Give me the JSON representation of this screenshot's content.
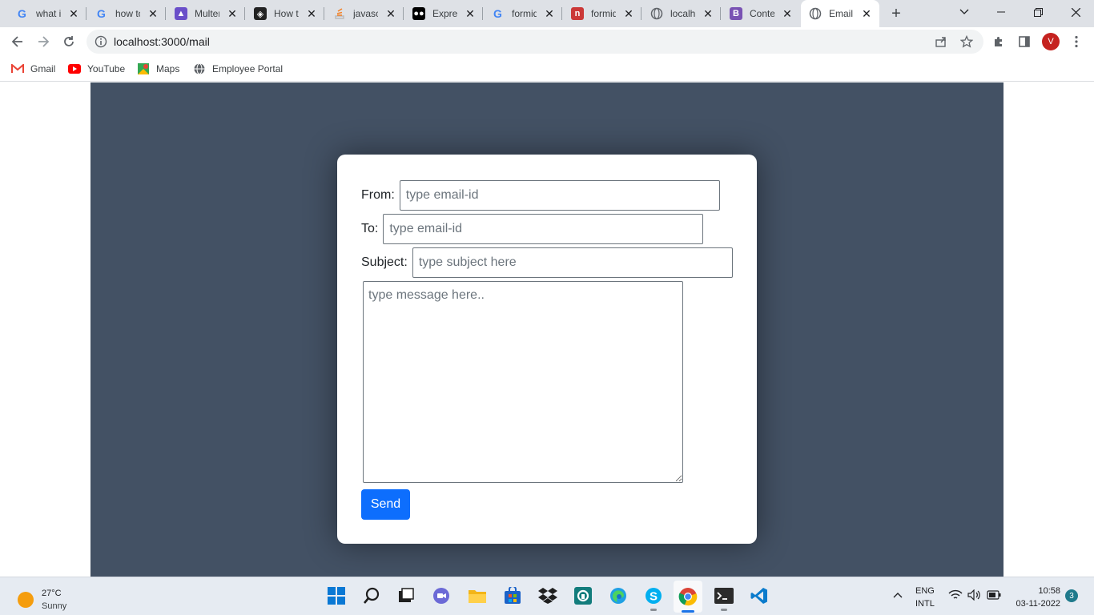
{
  "browser": {
    "tabs": [
      {
        "title": "what is",
        "icon": "google-icon",
        "active": false
      },
      {
        "title": "how to",
        "icon": "google-icon",
        "active": false
      },
      {
        "title": "Multer",
        "icon": "multer-icon",
        "active": false
      },
      {
        "title": "How to",
        "icon": "codepen-icon",
        "active": false
      },
      {
        "title": "javascr",
        "icon": "stackoverflow-icon",
        "active": false
      },
      {
        "title": "Expres",
        "icon": "medium-icon",
        "active": false
      },
      {
        "title": "formid",
        "icon": "google-icon",
        "active": false
      },
      {
        "title": "formid",
        "icon": "npm-icon",
        "active": false
      },
      {
        "title": "localho",
        "icon": "globe-icon",
        "active": false
      },
      {
        "title": "Conten",
        "icon": "bootstrap-icon",
        "active": false
      },
      {
        "title": "Email",
        "icon": "globe-icon",
        "active": true
      }
    ],
    "url": "localhost:3000/mail",
    "profile_initial": "V",
    "bookmarks": [
      {
        "label": "Gmail",
        "icon": "gmail-icon"
      },
      {
        "label": "YouTube",
        "icon": "youtube-icon"
      },
      {
        "label": "Maps",
        "icon": "maps-icon"
      },
      {
        "label": "Employee Portal",
        "icon": "globe-icon"
      }
    ]
  },
  "mail_form": {
    "from_label": "From:",
    "from_placeholder": "type email-id",
    "to_label": "To:",
    "to_placeholder": "type email-id",
    "subject_label": "Subject:",
    "subject_placeholder": "type subject here",
    "message_placeholder": "type message here..",
    "send_label": "Send"
  },
  "taskbar": {
    "weather_temp": "27°C",
    "weather_condition": "Sunny",
    "lang_top": "ENG",
    "lang_bottom": "INTL",
    "time": "10:58",
    "date": "03-11-2022",
    "notification_count": "3"
  },
  "colors": {
    "stage_bg": "#435164",
    "send_button": "#0d6efd",
    "tabstrip_bg": "#dee1e6"
  }
}
